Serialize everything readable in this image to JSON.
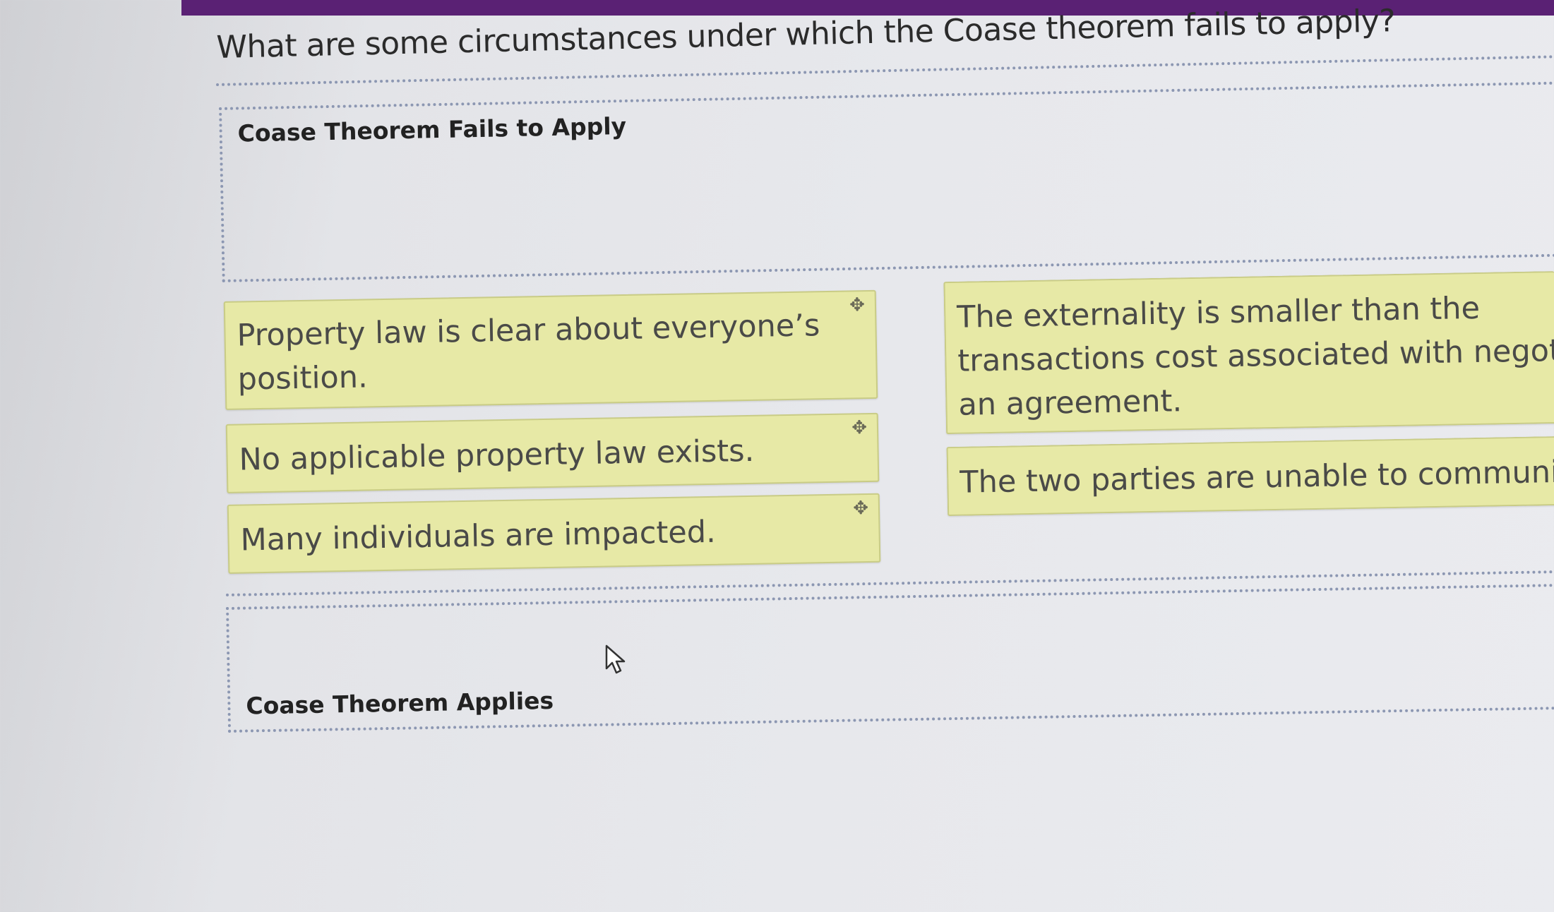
{
  "question": "What are some circumstances under which the Coase theorem fails to apply?",
  "zones": {
    "fails": {
      "title": "Coase Theorem Fails to Apply"
    },
    "applies": {
      "title": "Coase Theorem Applies"
    }
  },
  "cards": [
    {
      "text": "Property law is clear about everyone’s position."
    },
    {
      "text": "No applicable property law exists."
    },
    {
      "text": "Many individuals are impacted."
    },
    {
      "text": "The externality is smaller than the transactions cost associated with negotiating an agreement."
    },
    {
      "text": "The two parties are unable to communicate."
    }
  ],
  "icons": {
    "card_handle": "move-icon",
    "pointer": "mouse-cursor-icon"
  },
  "colors": {
    "card_background": "#e7e9a6",
    "header_bar": "#5a2174",
    "dotted_border": "#8c97b2"
  }
}
